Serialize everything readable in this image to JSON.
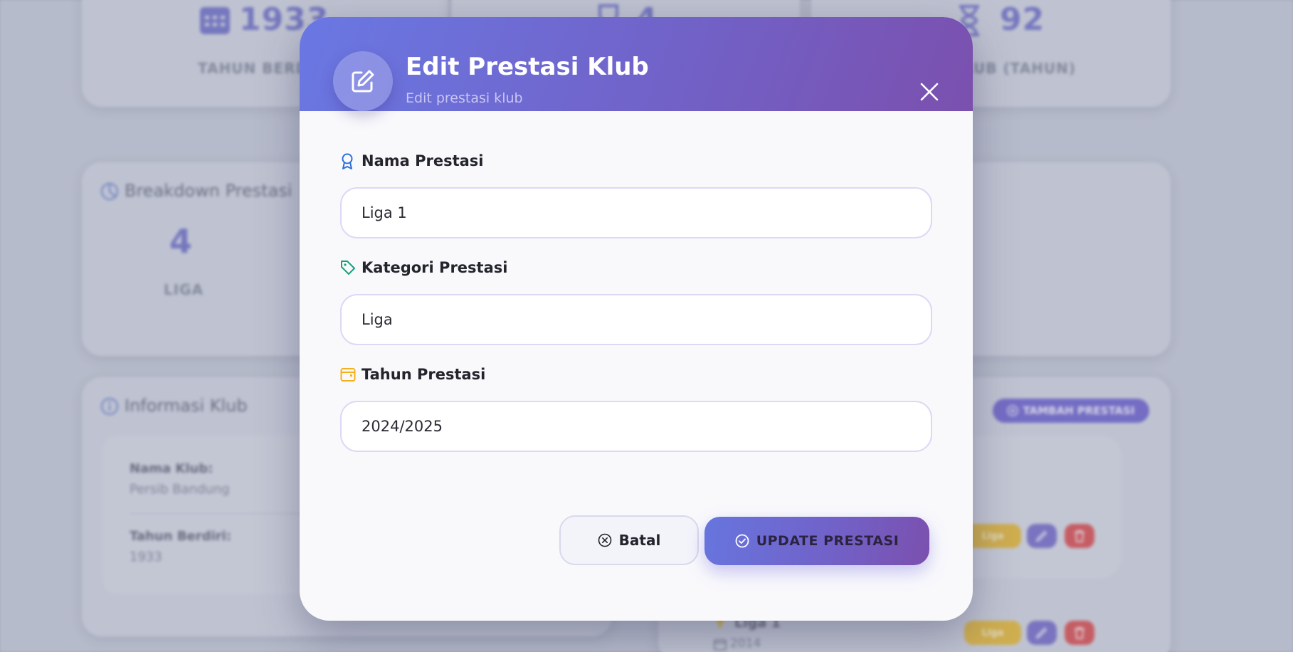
{
  "background": {
    "stats": [
      {
        "value": "1933",
        "label": "TAHUN BERDI",
        "icon": "calendar-icon"
      },
      {
        "value": "4",
        "label": "",
        "icon": "trophy-icon"
      },
      {
        "value": "92",
        "label": "LUB (TAHUN)",
        "icon": "hourglass-icon"
      }
    ],
    "breakdown": {
      "title": "Breakdown Prestasi",
      "icon": "pie-chart-icon",
      "count": "4",
      "count_label": "LIGA"
    },
    "info": {
      "title": "Informasi Klub",
      "icon": "info-icon",
      "rows": [
        {
          "key": "Nama Klub:",
          "value": "Persib Bandung"
        },
        {
          "key": "Tahun Berdiri:",
          "value": "1933"
        }
      ]
    },
    "achievements": {
      "add_button": "TAMBAH PRESTASI",
      "items": [
        {
          "tag": "Liga"
        },
        {
          "name": "Liga 1",
          "year": "2014",
          "tag": "Liga"
        }
      ]
    }
  },
  "modal": {
    "title": "Edit Prestasi Klub",
    "subtitle": "Edit prestasi klub",
    "header_icon": "edit-icon",
    "close_icon": "close-icon",
    "fields": {
      "nama": {
        "label": "Nama Prestasi",
        "value": "Liga 1",
        "icon": "award-icon",
        "icon_color": "#2f6fdc"
      },
      "kategori": {
        "label": "Kategori Prestasi",
        "value": "Liga",
        "icon": "tag-icon",
        "icon_color": "#17a17a"
      },
      "tahun": {
        "label": "Tahun Prestasi",
        "value": "2024/2025",
        "icon": "calendar-icon",
        "icon_color": "#f3b21b"
      }
    },
    "buttons": {
      "cancel": "Batal",
      "update": "UPDATE PRESTASI"
    }
  },
  "colors": {
    "header_gradient_start": "#6a78e3",
    "header_gradient_end": "#7b50ae",
    "accent": "#6d6cc8",
    "tag_yellow": "#e9b92f",
    "action_purple": "#7469c9",
    "action_red": "#dc4a4a"
  }
}
